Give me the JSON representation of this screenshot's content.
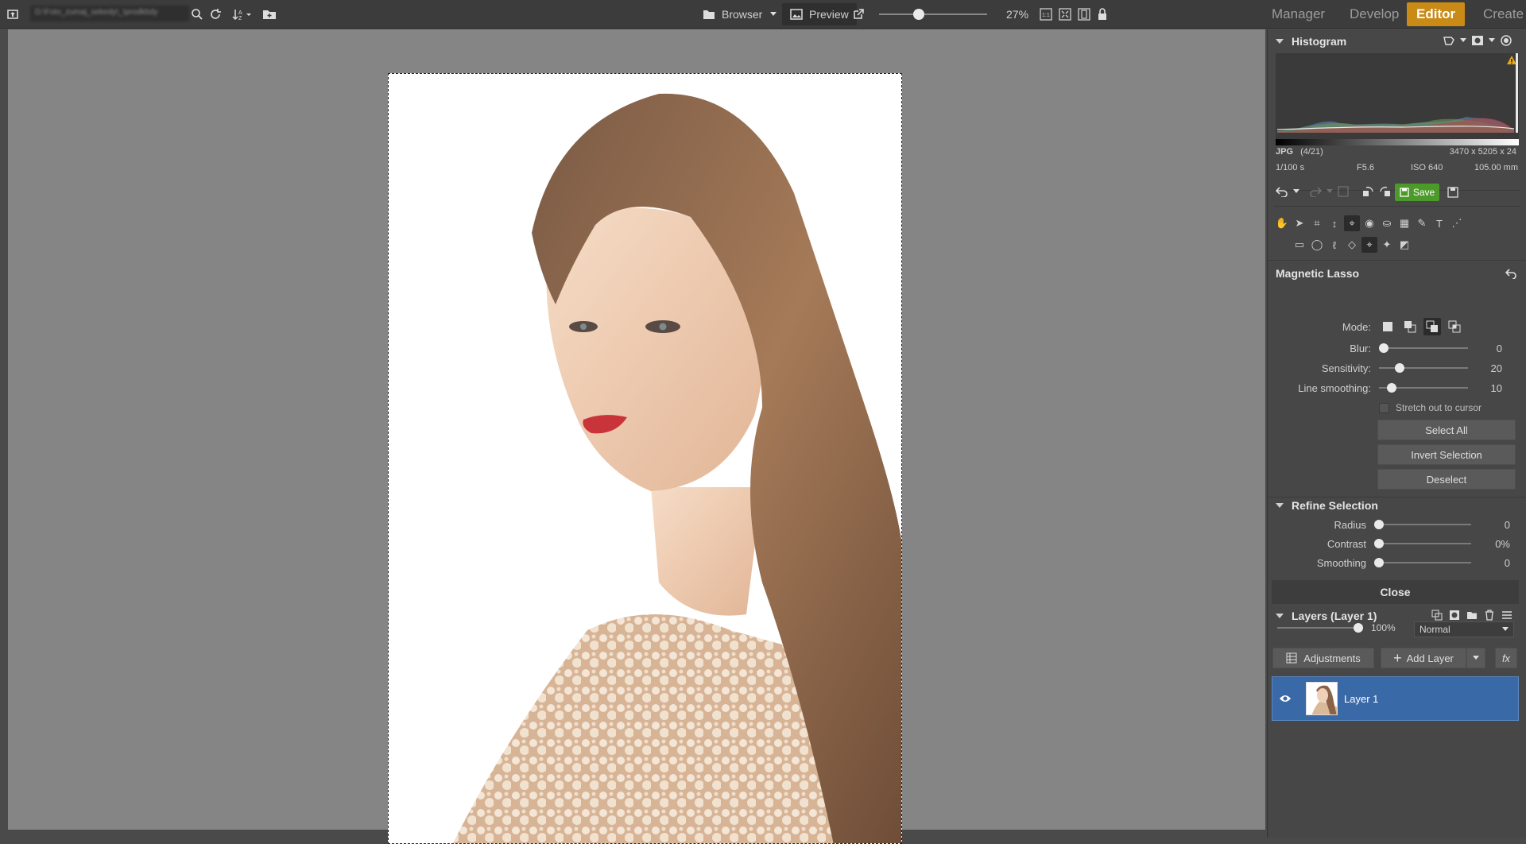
{
  "topbar": {
    "path_text": "D:\\Foto_zumaj_sekedy\\_\\prodkbdy",
    "browser_label": "Browser",
    "preview_label": "Preview",
    "zoom_value": 0.35,
    "zoom_text": "27%",
    "modes": [
      {
        "label": "Manager",
        "active": false
      },
      {
        "label": "Develop",
        "active": false
      },
      {
        "label": "Editor",
        "active": true
      },
      {
        "label": "Create",
        "active": false
      }
    ]
  },
  "histogram": {
    "title": "Histogram",
    "format": "JPG",
    "index": "(4/21)",
    "dimensions": "3470 x 5205 x 24",
    "shutter": "1/100 s",
    "aperture": "F5.6",
    "iso": "ISO 640",
    "focal": "105.00 mm"
  },
  "actions": {
    "save_label": "Save"
  },
  "tool_options": {
    "title": "Magnetic Lasso",
    "mode_label": "Mode:",
    "blur": {
      "label": "Blur:",
      "value": "0",
      "fraction": 0.0
    },
    "sensitivity": {
      "label": "Sensitivity:",
      "value": "20",
      "fraction": 0.2
    },
    "smoothing": {
      "label": "Line smoothing:",
      "value": "10",
      "fraction": 0.1
    },
    "stretch_label": "Stretch out to cursor",
    "select_all": "Select All",
    "invert": "Invert Selection",
    "deselect": "Deselect"
  },
  "refine": {
    "title": "Refine Selection",
    "radius": {
      "label": "Radius",
      "value": "0",
      "fraction": 0.0
    },
    "contrast": {
      "label": "Contrast",
      "value": "0%",
      "fraction": 0.0
    },
    "smoothing": {
      "label": "Smoothing",
      "value": "0",
      "fraction": 0.0
    },
    "close_label": "Close"
  },
  "layers": {
    "title": "Layers (Layer 1)",
    "opacity": "100%",
    "opacity_fraction": 1.0,
    "blend_mode": "Normal",
    "adjustments_label": "Adjustments",
    "add_layer_label": "Add Layer",
    "fx_label": "fx",
    "items": [
      {
        "name": "Layer 1",
        "visible": true
      }
    ]
  },
  "colors": {
    "accent": "#c98a16",
    "save_green": "#4c9a2a",
    "layer_selected": "#3a69a8"
  }
}
